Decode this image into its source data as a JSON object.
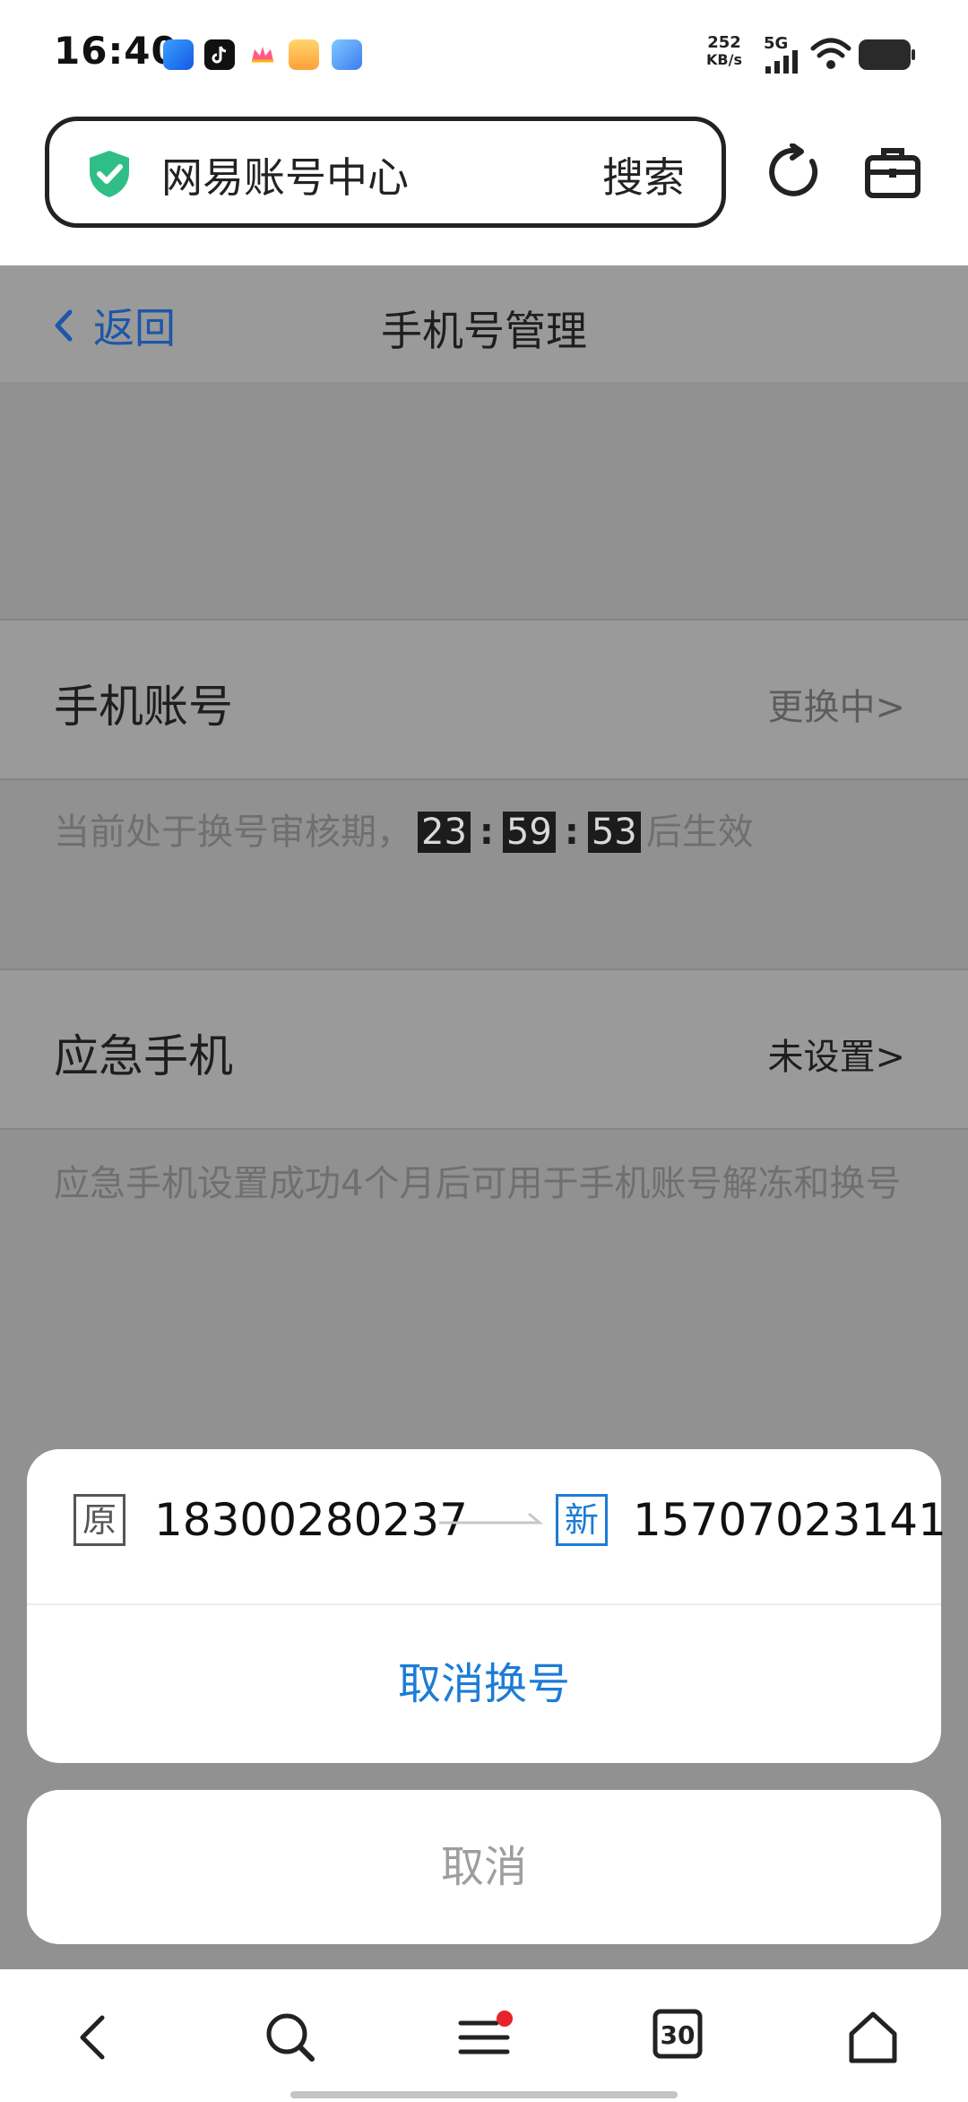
{
  "status_bar": {
    "time": "16:40",
    "net_speed_value": "252",
    "net_speed_unit": "KB/s",
    "network_type": "5G",
    "battery_icon": "battery-icon",
    "wifi_icon": "wifi-icon",
    "signal_icon": "signal-icon"
  },
  "browser": {
    "site_title": "网易账号中心",
    "search_label": "搜索",
    "secure_icon": "shield-check-icon",
    "refresh_icon": "refresh-icon",
    "toolbox_icon": "toolbox-icon"
  },
  "page": {
    "back_label": "返回",
    "title": "手机号管理",
    "phone_account": {
      "label": "手机账号",
      "status": "更换中>",
      "hint_prefix": "当前处于换号审核期，",
      "timer_hours": "23",
      "timer_minutes": "59",
      "timer_seconds": "53",
      "timer_sep": ":",
      "hint_suffix": "后生效"
    },
    "emergency_phone": {
      "label": "应急手机",
      "status": "未设置>",
      "hint": "应急手机设置成功4个月后可用于手机账号解冻和换号"
    }
  },
  "action_sheet": {
    "old_tag": "原",
    "old_number": "18300280237",
    "new_tag": "新",
    "new_number": "15707023141",
    "cancel_change_label": "取消换号",
    "cancel_label": "取消"
  },
  "bottom_nav": {
    "tabs_badge": "30",
    "colors": {
      "accent_blue": "#1c7cd5",
      "badge_red": "#e8232b"
    }
  }
}
